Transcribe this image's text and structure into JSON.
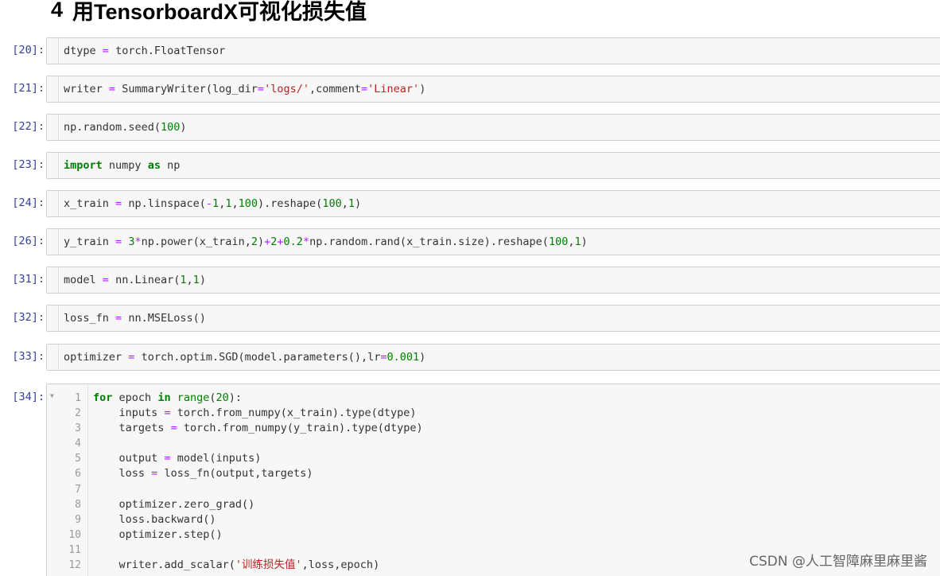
{
  "heading": {
    "number": "4",
    "title": "用TensorboardX可视化损失值"
  },
  "cells": [
    {
      "prompt": "[20]:",
      "code": "dtype = torch.FloatTensor"
    },
    {
      "prompt": "[21]:",
      "code": "writer = SummaryWriter(log_dir='logs/',comment='Linear')"
    },
    {
      "prompt": "[22]:",
      "code": "np.random.seed(100)"
    },
    {
      "prompt": "[23]:",
      "code": "import numpy as np"
    },
    {
      "prompt": "[24]:",
      "code": "x_train = np.linspace(-1,1,100).reshape(100,1)"
    },
    {
      "prompt": "[26]:",
      "code": "y_train = 3*np.power(x_train,2)+2+0.2*np.random.rand(x_train.size).reshape(100,1)"
    },
    {
      "prompt": "[31]:",
      "code": "model = nn.Linear(1,1)"
    },
    {
      "prompt": "[32]:",
      "code": "loss_fn = nn.MSELoss()"
    },
    {
      "prompt": "[33]:",
      "code": "optimizer = torch.optim.SGD(model.parameters(),lr=0.001)"
    }
  ],
  "multi_cell": {
    "prompt": "[34]:",
    "fold_icon": "triangle-down-icon",
    "lines": [
      {
        "n": "1",
        "code": "for epoch in range(20):"
      },
      {
        "n": "2",
        "code": "    inputs = torch.from_numpy(x_train).type(dtype)"
      },
      {
        "n": "3",
        "code": "    targets = torch.from_numpy(y_train).type(dtype)"
      },
      {
        "n": "4",
        "code": ""
      },
      {
        "n": "5",
        "code": "    output = model(inputs)"
      },
      {
        "n": "6",
        "code": "    loss = loss_fn(output,targets)"
      },
      {
        "n": "7",
        "code": ""
      },
      {
        "n": "8",
        "code": "    optimizer.zero_grad()"
      },
      {
        "n": "9",
        "code": "    loss.backward()"
      },
      {
        "n": "10",
        "code": "    optimizer.step()"
      },
      {
        "n": "11",
        "code": ""
      },
      {
        "n": "12",
        "code": "    writer.add_scalar('训练损失值',loss,epoch)"
      }
    ]
  },
  "watermark": "CSDN @人工智障麻里麻里酱",
  "colors": {
    "prompt": "#303f9f",
    "keyword": "#008000",
    "operator": "#aa22ff",
    "number": "#008000",
    "string": "#ba2121",
    "cell_bg": "#f7f7f7",
    "cell_border": "#cfcfcf"
  }
}
